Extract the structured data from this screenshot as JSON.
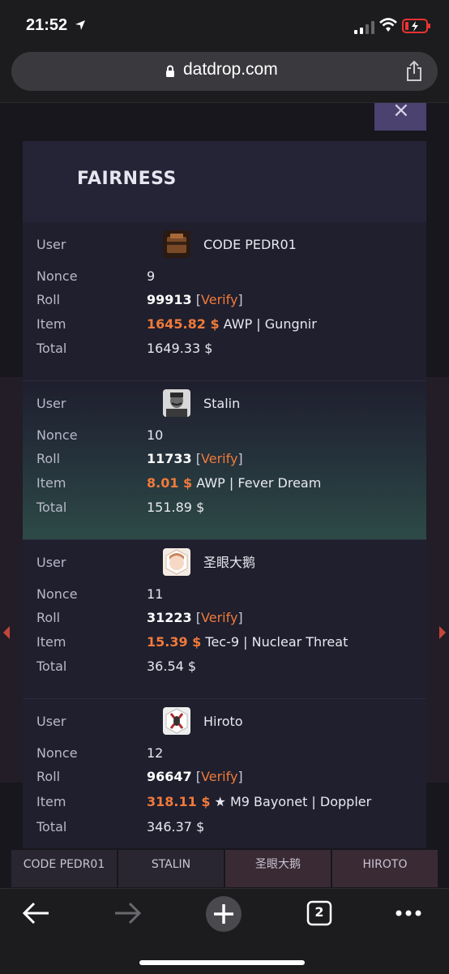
{
  "status_bar": {
    "time": "21:52"
  },
  "browser": {
    "url": "datdrop.com",
    "tab_count": "2"
  },
  "background_page": {
    "tiles": [
      "CODE PEDR01",
      "STALIN",
      "圣眼大鹅",
      "HIROTO"
    ],
    "close_label": "×"
  },
  "modal": {
    "title": "FAIRNESS",
    "labels": {
      "user": "User",
      "nonce": "Nonce",
      "roll": "Roll",
      "item": "Item",
      "total": "Total"
    },
    "verify_label": "Verify",
    "entries": [
      {
        "user": "CODE PEDR01",
        "nonce": "9",
        "roll": "99913",
        "item_price": "1645.82 $",
        "item_name": "AWP | Gungnir",
        "total": "1649.33 $"
      },
      {
        "user": "Stalin",
        "nonce": "10",
        "roll": "11733",
        "item_price": "8.01 $",
        "item_name": "AWP | Fever Dream",
        "total": "151.89 $"
      },
      {
        "user": "圣眼大鹅",
        "nonce": "11",
        "roll": "31223",
        "item_price": "15.39 $",
        "item_name": "Tec-9 | Nuclear Threat",
        "total": "36.54 $"
      },
      {
        "user": "Hiroto",
        "nonce": "12",
        "roll": "96647",
        "item_price": "318.11 $",
        "item_name": "★ M9 Bayonet | Doppler",
        "total": "346.37 $"
      }
    ]
  },
  "colors": {
    "accent": "#f07a3a",
    "modal_bg": "#1f1f2e"
  },
  "icons": [
    "location-arrow-icon",
    "cellular-signal-icon",
    "wifi-icon",
    "battery-icon",
    "lock-icon",
    "share-icon",
    "close-icon",
    "back-arrow-icon",
    "forward-arrow-icon",
    "new-tab-plus-icon",
    "tabs-icon",
    "more-icon"
  ]
}
